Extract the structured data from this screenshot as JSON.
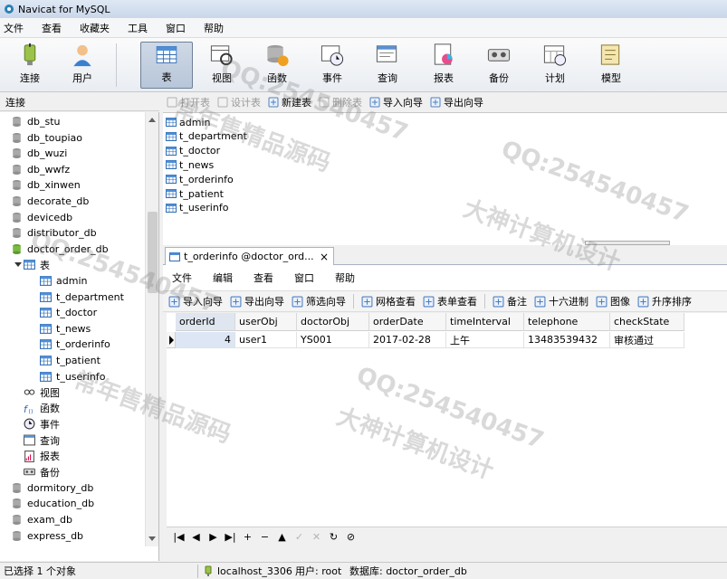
{
  "window": {
    "title": "Navicat for MySQL"
  },
  "menubar": [
    "文件",
    "查看",
    "收藏夹",
    "工具",
    "窗口",
    "帮助"
  ],
  "ribbon": [
    {
      "label": "连接",
      "icon": "connection-icon"
    },
    {
      "label": "用户",
      "icon": "user-icon"
    },
    {
      "label": "表",
      "icon": "table-icon",
      "active": true
    },
    {
      "label": "视图",
      "icon": "view-icon"
    },
    {
      "label": "函数",
      "icon": "function-icon"
    },
    {
      "label": "事件",
      "icon": "event-icon"
    },
    {
      "label": "查询",
      "icon": "query-icon"
    },
    {
      "label": "报表",
      "icon": "report-icon"
    },
    {
      "label": "备份",
      "icon": "backup-icon"
    },
    {
      "label": "计划",
      "icon": "schedule-icon"
    },
    {
      "label": "模型",
      "icon": "model-icon"
    }
  ],
  "left_panel": {
    "header": "连接",
    "databases_before": [
      "db_stu",
      "db_toupiao",
      "db_wuzi",
      "db_wwfz",
      "db_xinwen",
      "decorate_db",
      "devicedb",
      "distributor_db"
    ],
    "open_db": "doctor_order_db",
    "tables_node": "表",
    "tables": [
      "admin",
      "t_department",
      "t_doctor",
      "t_news",
      "t_orderinfo",
      "t_patient",
      "t_userinfo"
    ],
    "other_nodes": [
      "视图",
      "函数",
      "事件",
      "查询",
      "报表",
      "备份"
    ],
    "databases_after": [
      "dormitory_db",
      "education_db",
      "exam_db",
      "express_db"
    ]
  },
  "object_toolbar": [
    {
      "label": "打开表",
      "disabled": true
    },
    {
      "label": "设计表",
      "disabled": true
    },
    {
      "label": "新建表",
      "disabled": false
    },
    {
      "label": "删除表",
      "disabled": true
    },
    {
      "label": "导入向导",
      "disabled": false
    },
    {
      "label": "导出向导",
      "disabled": false
    }
  ],
  "object_list": [
    "admin",
    "t_department",
    "t_doctor",
    "t_news",
    "t_orderinfo",
    "t_patient",
    "t_userinfo"
  ],
  "document_tab": {
    "label": "t_orderinfo @doctor_ord...",
    "close": "×"
  },
  "inner_menu": [
    "文件",
    "编辑",
    "查看",
    "窗口",
    "帮助"
  ],
  "inner_toolbar": [
    "导入向导",
    "导出向导",
    "筛选向导",
    "网格查看",
    "表单查看",
    "备注",
    "十六进制",
    "图像",
    "升序排序"
  ],
  "grid": {
    "columns": [
      "orderId",
      "userObj",
      "doctorObj",
      "orderDate",
      "timeInterval",
      "telephone",
      "checkState"
    ],
    "rows": [
      [
        "4",
        "user1",
        "YS001",
        "2017-02-28",
        "上午",
        "13483539432",
        "审核通过"
      ]
    ]
  },
  "navbar": [
    "|◀",
    "◀",
    "▶",
    "▶|",
    "+",
    "−",
    "▲",
    "✓",
    "✕",
    "↻",
    "⊘"
  ],
  "statusbar": {
    "selection": "已选择 1 个对象",
    "connection": "localhost_3306",
    "user": "用户: root",
    "database": "数据库: doctor_order_db"
  },
  "watermarks": [
    "QQ:254540457",
    "大神计算机设计",
    "常年售精品源码"
  ],
  "colors": {
    "active_tab": "#b7c6d9",
    "selected_cell": "#dce6f4",
    "db_icon": "#9a9a9a",
    "open_db_icon": "#6fae3c"
  }
}
